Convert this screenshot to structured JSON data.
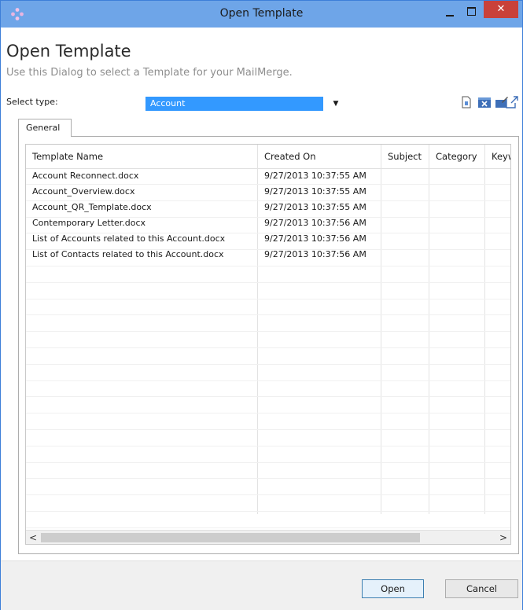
{
  "window": {
    "title": "Open Template",
    "close_glyph": "✕",
    "icons": [
      "app-logo-icon",
      "minimize-icon",
      "maximize-icon",
      "close-icon"
    ]
  },
  "header": {
    "heading": "Open Template",
    "subtitle": "Use this Dialog to select a Template for your MailMerge."
  },
  "type_select": {
    "label": "Select type:",
    "value": "Account",
    "arrow": "▼"
  },
  "toolbar_icons": [
    "new-document-icon",
    "delete-icon",
    "edit-icon",
    "open-external-icon"
  ],
  "tabs": [
    {
      "label": "General"
    }
  ],
  "table": {
    "columns": [
      "Template Name",
      "Created On",
      "Subject",
      "Category",
      "Keyw"
    ],
    "rows": [
      [
        "Account Reconnect.docx",
        "9/27/2013 10:37:55 AM",
        "",
        "",
        ""
      ],
      [
        "Account_Overview.docx",
        "9/27/2013 10:37:55 AM",
        "",
        "",
        ""
      ],
      [
        "Account_QR_Template.docx",
        "9/27/2013 10:37:55 AM",
        "",
        "",
        ""
      ],
      [
        "Contemporary Letter.docx",
        "9/27/2013 10:37:56 AM",
        "",
        "",
        ""
      ],
      [
        "List of Accounts related to this Account.docx",
        "9/27/2013 10:37:56 AM",
        "",
        "",
        ""
      ],
      [
        "List of Contacts related to this Account.docx",
        "9/27/2013 10:37:56 AM",
        "",
        "",
        ""
      ]
    ]
  },
  "scrollbar": {
    "left_glyph": "<",
    "right_glyph": ">"
  },
  "buttons": {
    "open": "Open",
    "cancel": "Cancel"
  },
  "colors": {
    "titlebar": "#6ea5e8",
    "close_button": "#c9413a",
    "selection": "#3399ff"
  }
}
